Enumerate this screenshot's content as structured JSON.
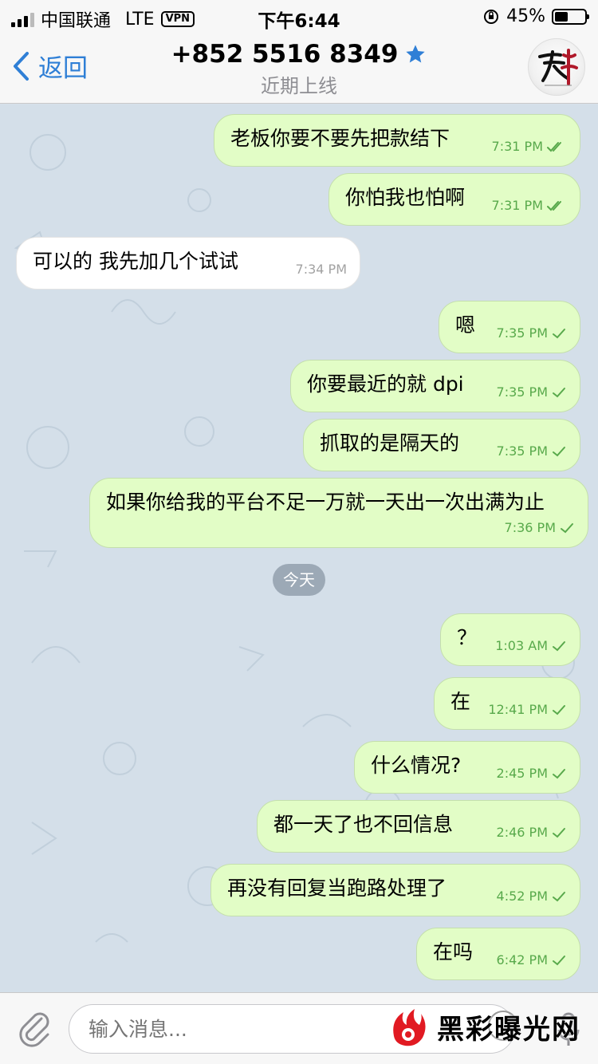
{
  "status": {
    "carrier": "中国联通",
    "network": "LTE",
    "vpn": "VPN",
    "time": "下午6:44",
    "battery": "45%",
    "battery_level": 0.45
  },
  "header": {
    "back_label": "返回",
    "title": "+852 5516 8349",
    "subtitle": "近期上线"
  },
  "messages": [
    {
      "text": "老板你要不要先把款结下",
      "time": "7:31 PM",
      "read": true
    },
    {
      "text": "你怕我也怕啊",
      "time": "7:31 PM",
      "read": true
    },
    {
      "text": "可以的  我先加几个试试",
      "time": "7:34 PM"
    },
    {
      "text": "嗯",
      "time": "7:35 PM",
      "read": false
    },
    {
      "text": "你要最近的就 dpi",
      "time": "7:35 PM",
      "read": false
    },
    {
      "text": "抓取的是隔天的",
      "time": "7:35 PM",
      "read": false
    },
    {
      "text": "如果你给我的平台不足一万就一天出一次出满为止",
      "time": "7:36 PM",
      "read": false
    },
    {
      "text": "？",
      "time": "1:03 AM",
      "read": false
    },
    {
      "text": "在",
      "time": "12:41 PM",
      "read": false
    },
    {
      "text": "什么情况?",
      "time": "2:45 PM",
      "read": false
    },
    {
      "text": "都一天了也不回信息",
      "time": "2:46 PM",
      "read": false
    },
    {
      "text": "再没有回复当跑路处理了",
      "time": "4:52 PM",
      "read": false
    },
    {
      "text": "在吗",
      "time": "6:42 PM",
      "read": false
    }
  ],
  "date_separator": "今天",
  "composer": {
    "placeholder": "输入消息..."
  },
  "watermark": "黑彩曝光网",
  "colors": {
    "accent": "#2f7fd6",
    "outgoing_bubble": "#e2fdc6",
    "incoming_bubble": "#ffffff",
    "check": "#58a94b"
  }
}
